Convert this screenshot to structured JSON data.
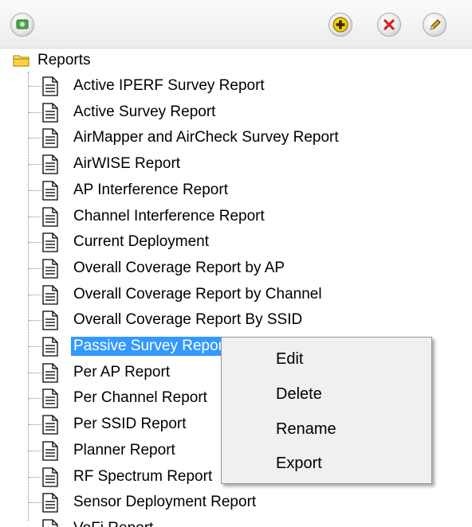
{
  "toolbar": {
    "left_icon": "refresh-icon",
    "buttons": [
      {
        "name": "add-button",
        "icon": "plus-icon",
        "color": "#e8c000"
      },
      {
        "name": "delete-button",
        "icon": "x-icon",
        "color": "#d2232a"
      },
      {
        "name": "edit-button",
        "icon": "pencil-icon",
        "color": "#d89a1a"
      }
    ]
  },
  "tree": {
    "root_label": "Reports",
    "items": [
      {
        "label": "Active IPERF Survey Report"
      },
      {
        "label": "Active Survey Report"
      },
      {
        "label": "AirMapper and AirCheck Survey Report"
      },
      {
        "label": "AirWISE Report"
      },
      {
        "label": "AP Interference Report"
      },
      {
        "label": "Channel Interference Report"
      },
      {
        "label": "Current Deployment"
      },
      {
        "label": "Overall Coverage Report by AP"
      },
      {
        "label": "Overall Coverage Report by Channel"
      },
      {
        "label": "Overall Coverage Report By SSID"
      },
      {
        "label": "Passive Survey Report",
        "selected": true
      },
      {
        "label": "Per AP Report"
      },
      {
        "label": "Per Channel Report"
      },
      {
        "label": "Per SSID Report"
      },
      {
        "label": "Planner Report"
      },
      {
        "label": "RF Spectrum Report"
      },
      {
        "label": "Sensor Deployment Report"
      },
      {
        "label": "VoFi Report"
      }
    ]
  },
  "context_menu": {
    "items": [
      {
        "label": "Edit"
      },
      {
        "label": "Delete"
      },
      {
        "label": "Rename"
      },
      {
        "label": "Export"
      }
    ]
  },
  "colors": {
    "selection": "#3399ff",
    "menu_bg": "#f0f0f0"
  }
}
